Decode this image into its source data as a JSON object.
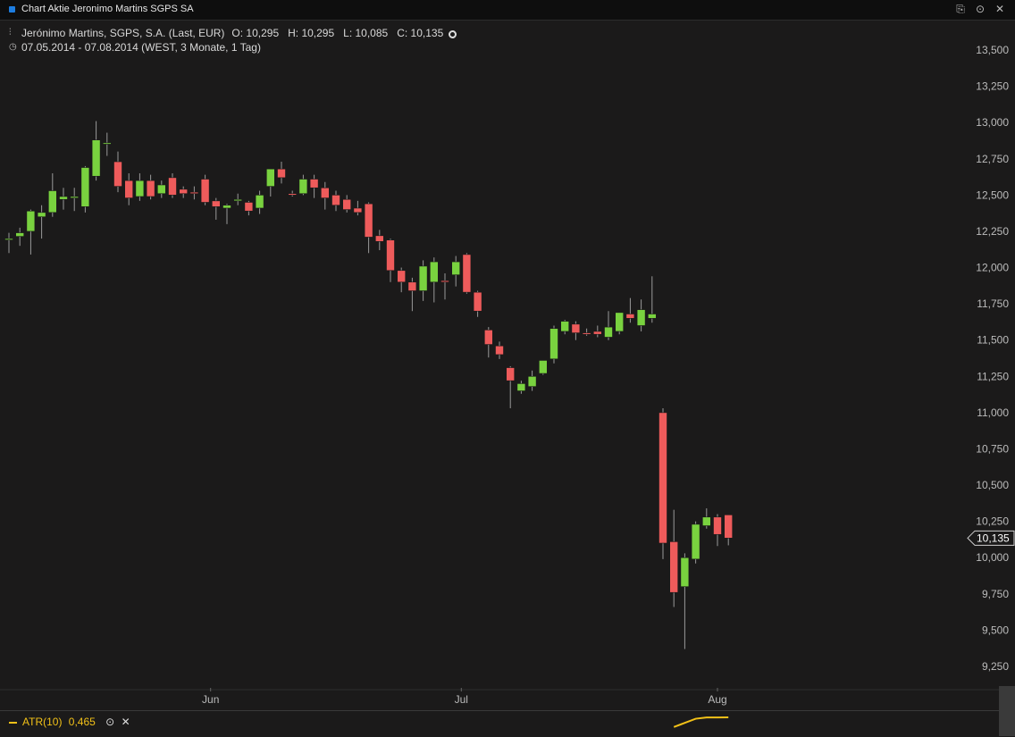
{
  "window": {
    "title": "Chart Aktie Jeronimo Martins SGPS SA"
  },
  "info": {
    "instrument": "Jerónimo Martins, SGPS, S.A. (Last, EUR)",
    "ohlc": "O: 10,295   H: 10,295   L: 10,085   C: 10,135",
    "range": "07.05.2014 - 07.08.2014 (WEST, 3 Monate, 1 Tag)"
  },
  "indicator": {
    "name": "ATR(10)",
    "value": "0,465",
    "color": "#f2c118"
  },
  "colors": {
    "up": "#79d23f",
    "down": "#ee5b5b",
    "wick": "#9a9a9a",
    "price_tag": "#d0d0d0"
  },
  "chart_data": {
    "type": "candlestick",
    "ylim": [
      9.25,
      13.5
    ],
    "yticks": [
      "9,250",
      "9,500",
      "9,750",
      "10,000",
      "10,250",
      "10,500",
      "10,750",
      "11,000",
      "11,250",
      "11,500",
      "11,750",
      "12,000",
      "12,250",
      "12,500",
      "12,750",
      "13,000",
      "13,250",
      "13,500"
    ],
    "xticks": [
      {
        "label": "Jun",
        "index": 18.5
      },
      {
        "label": "Jul",
        "index": 41.5
      },
      {
        "label": "Aug",
        "index": 65
      }
    ],
    "last_price": "10,135",
    "candles": [
      [
        12.195,
        12.24,
        12.1,
        12.2
      ],
      [
        12.215,
        12.275,
        12.15,
        12.24
      ],
      [
        12.25,
        12.4,
        12.09,
        12.39
      ],
      [
        12.35,
        12.43,
        12.2,
        12.38
      ],
      [
        12.38,
        12.65,
        12.35,
        12.53
      ],
      [
        12.47,
        12.55,
        12.4,
        12.49
      ],
      [
        12.48,
        12.55,
        12.39,
        12.49
      ],
      [
        12.42,
        12.7,
        12.38,
        12.69
      ],
      [
        12.63,
        13.01,
        12.6,
        12.88
      ],
      [
        12.86,
        12.93,
        12.77,
        12.86
      ],
      [
        12.73,
        12.8,
        12.52,
        12.56
      ],
      [
        12.6,
        12.65,
        12.43,
        12.48
      ],
      [
        12.49,
        12.65,
        12.46,
        12.6
      ],
      [
        12.6,
        12.64,
        12.47,
        12.49
      ],
      [
        12.51,
        12.6,
        12.48,
        12.57
      ],
      [
        12.62,
        12.65,
        12.48,
        12.5
      ],
      [
        12.54,
        12.56,
        12.48,
        12.51
      ],
      [
        12.52,
        12.56,
        12.47,
        12.51
      ],
      [
        12.61,
        12.64,
        12.43,
        12.45
      ],
      [
        12.46,
        12.48,
        12.33,
        12.42
      ],
      [
        12.41,
        12.44,
        12.3,
        12.43
      ],
      [
        12.46,
        12.51,
        12.43,
        12.47
      ],
      [
        12.45,
        12.46,
        12.36,
        12.39
      ],
      [
        12.41,
        12.53,
        12.37,
        12.5
      ],
      [
        12.56,
        12.62,
        12.49,
        12.68
      ],
      [
        12.68,
        12.73,
        12.58,
        12.62
      ],
      [
        12.51,
        12.53,
        12.49,
        12.5
      ],
      [
        12.51,
        12.64,
        12.5,
        12.61
      ],
      [
        12.61,
        12.64,
        12.48,
        12.55
      ],
      [
        12.55,
        12.59,
        12.4,
        12.48
      ],
      [
        12.5,
        12.53,
        12.39,
        12.43
      ],
      [
        12.47,
        12.5,
        12.38,
        12.4
      ],
      [
        12.41,
        12.46,
        12.36,
        12.38
      ],
      [
        12.44,
        12.45,
        12.1,
        12.21
      ],
      [
        12.22,
        12.26,
        12.12,
        12.18
      ],
      [
        12.19,
        12.2,
        11.9,
        11.98
      ],
      [
        11.98,
        12.0,
        11.83,
        11.9
      ],
      [
        11.9,
        11.93,
        11.7,
        11.84
      ],
      [
        11.84,
        12.05,
        11.77,
        12.01
      ],
      [
        11.9,
        12.07,
        11.76,
        12.04
      ],
      [
        11.91,
        11.96,
        11.78,
        11.9
      ],
      [
        11.95,
        12.08,
        11.87,
        12.04
      ],
      [
        12.09,
        12.1,
        11.82,
        11.83
      ],
      [
        11.83,
        11.84,
        11.66,
        11.7
      ],
      [
        11.57,
        11.59,
        11.38,
        11.47
      ],
      [
        11.46,
        11.49,
        11.37,
        11.4
      ],
      [
        11.31,
        11.32,
        11.03,
        11.22
      ],
      [
        11.15,
        11.22,
        11.13,
        11.2
      ],
      [
        11.18,
        11.29,
        11.15,
        11.25
      ],
      [
        11.27,
        11.36,
        11.26,
        11.36
      ],
      [
        11.37,
        11.6,
        11.34,
        11.58
      ],
      [
        11.56,
        11.64,
        11.54,
        11.63
      ],
      [
        11.61,
        11.63,
        11.5,
        11.55
      ],
      [
        11.55,
        11.58,
        11.53,
        11.54
      ],
      [
        11.56,
        11.6,
        11.52,
        11.54
      ],
      [
        11.52,
        11.7,
        11.5,
        11.59
      ],
      [
        11.56,
        11.69,
        11.54,
        11.69
      ],
      [
        11.68,
        11.79,
        11.62,
        11.65
      ],
      [
        11.6,
        11.78,
        11.56,
        11.71
      ],
      [
        11.65,
        11.94,
        11.62,
        11.68
      ],
      [
        11.0,
        11.03,
        9.99,
        10.1
      ],
      [
        10.11,
        10.33,
        9.66,
        9.76
      ],
      [
        9.8,
        10.03,
        9.37,
        10.0
      ],
      [
        9.99,
        10.25,
        9.96,
        10.23
      ],
      [
        10.22,
        10.34,
        10.2,
        10.28
      ],
      [
        10.28,
        10.3,
        10.08,
        10.16
      ],
      [
        10.295,
        10.295,
        10.085,
        10.135
      ]
    ],
    "atr_series": [
      0.29,
      0.365,
      0.44,
      0.462,
      0.462,
      0.465
    ]
  }
}
